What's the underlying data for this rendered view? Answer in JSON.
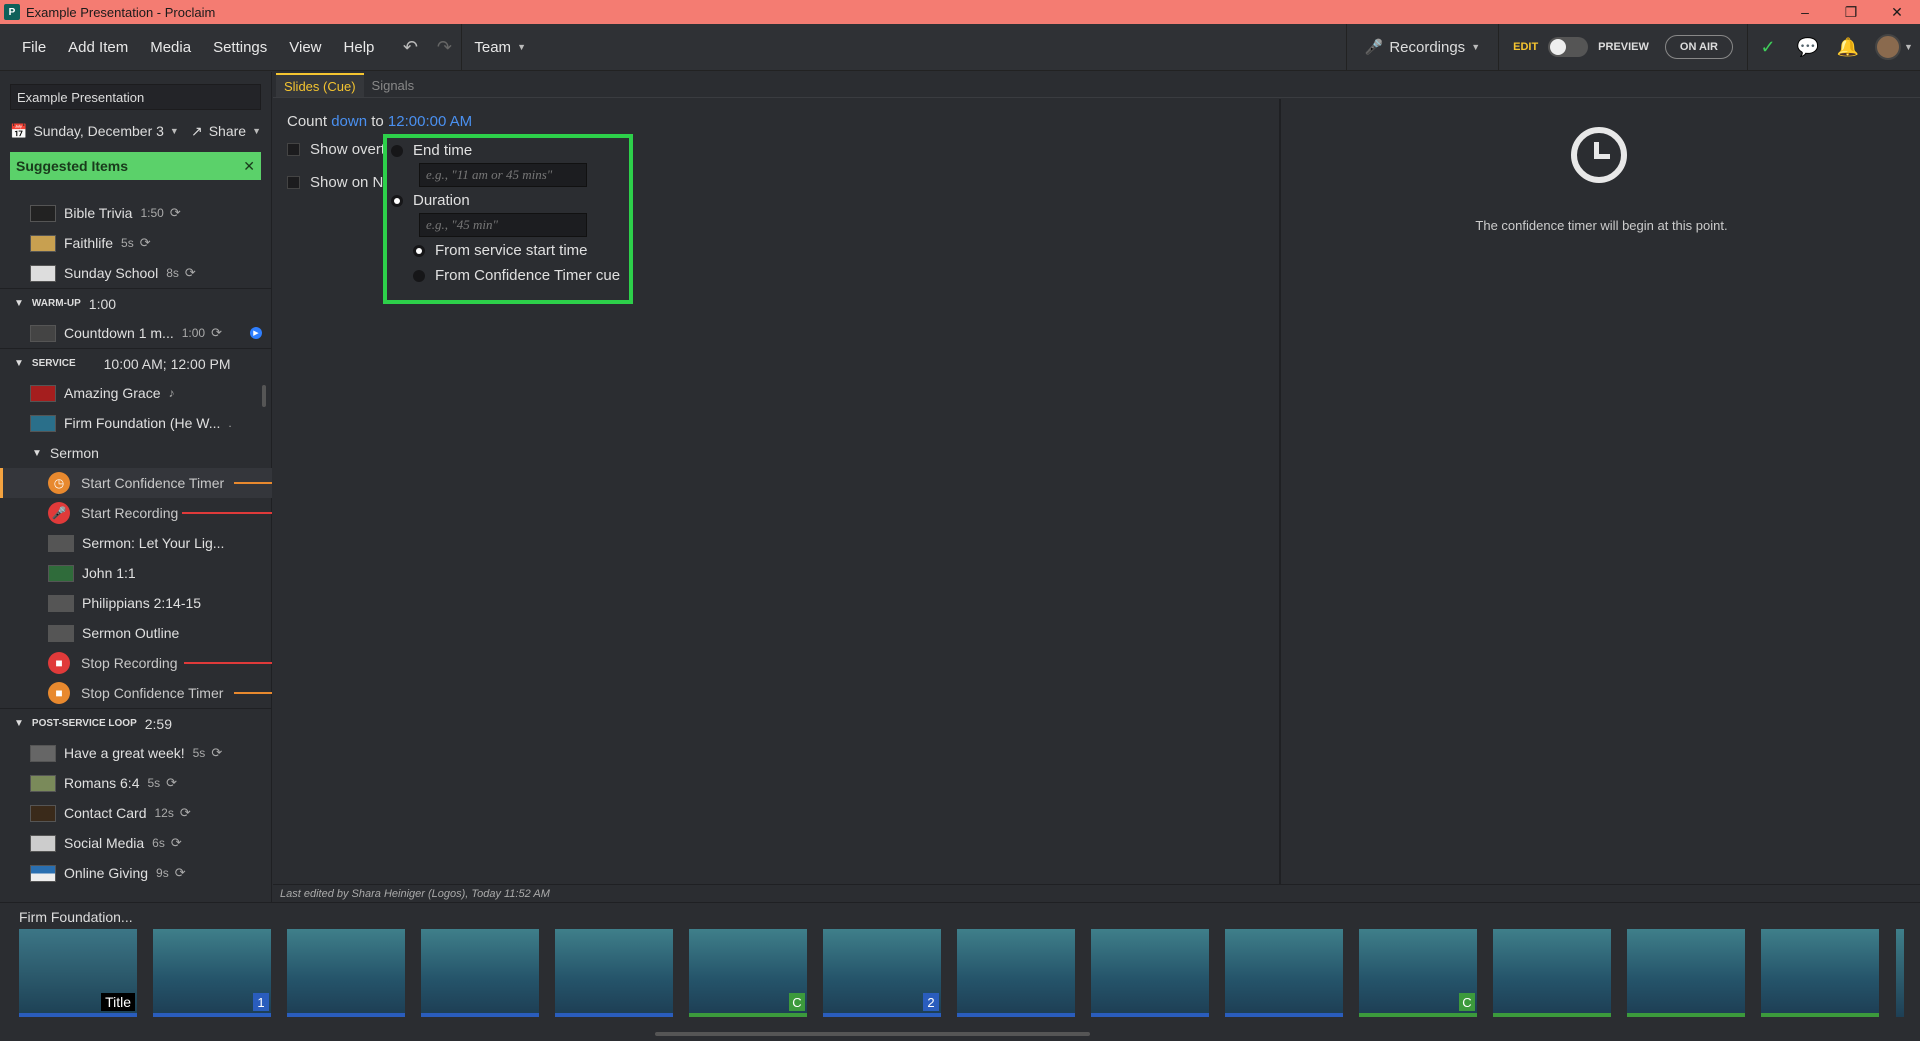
{
  "window": {
    "title": "Example Presentation - Proclaim"
  },
  "menu": {
    "items": [
      "File",
      "Add Item",
      "Media",
      "Settings",
      "View",
      "Help"
    ],
    "team": "Team",
    "recordings": "Recordings",
    "edit": "EDIT",
    "preview": "PREVIEW",
    "on_air": "ON AIR"
  },
  "sidebar": {
    "presentation_title": "Example Presentation",
    "date": "Sunday, December 3",
    "share": "Share",
    "suggested": "Suggested Items",
    "pre_items": [
      {
        "name": "Bible Trivia",
        "dur": "1:50",
        "color": "#222"
      },
      {
        "name": "Faithlife",
        "dur": "5s",
        "color": "#c8a050"
      },
      {
        "name": "Sunday School",
        "dur": "8s",
        "color": "#ddd"
      }
    ],
    "warmup": {
      "label": "WARM-UP",
      "value": "1:00",
      "item": "Countdown 1 m...",
      "dur": "1:00"
    },
    "service": {
      "label": "SERVICE",
      "value": "10:00 AM; 12:00 PM",
      "items": [
        {
          "name": "Amazing Grace",
          "extra": "♪"
        },
        {
          "name": "Firm Foundation (He W...",
          "extra": "."
        }
      ],
      "group": "Sermon",
      "cues": [
        {
          "name": "Start Confidence Timer",
          "icon": "clock",
          "color": "#e8892e",
          "line": "#e8892e"
        },
        {
          "name": "Start Recording",
          "icon": "mic",
          "color": "#e03a3a",
          "line": "#e03a3a"
        }
      ],
      "sermon_items": [
        "Sermon: Let Your Lig...",
        "John 1:1",
        "Philippians 2:14-15",
        "Sermon Outline"
      ],
      "end_cues": [
        {
          "name": "Stop Recording",
          "color": "#e03a3a"
        },
        {
          "name": "Stop Confidence Timer",
          "color": "#e8892e"
        }
      ]
    },
    "post": {
      "label": "POST-SERVICE LOOP",
      "value": "2:59",
      "items": [
        {
          "name": "Have a great week!",
          "dur": "5s"
        },
        {
          "name": "Romans 6:4",
          "dur": "5s"
        },
        {
          "name": "Contact Card",
          "dur": "12s"
        },
        {
          "name": "Social Media",
          "dur": "6s"
        },
        {
          "name": "Online Giving",
          "dur": "9s"
        }
      ]
    }
  },
  "tabs": [
    "Slides (Cue)",
    "Signals"
  ],
  "main": {
    "count_prefix": "Count",
    "count_dir": "down",
    "count_to": "to",
    "count_time": "12:00:00 AM",
    "show_overtime": "Show overti",
    "show_on": "Show on No",
    "end_time_label": "End time",
    "end_time_placeholder": "e.g., \"11 am or 45 mins\"",
    "duration_label": "Duration",
    "duration_placeholder": "e.g., \"45 min\"",
    "from_service": "From service start time",
    "from_cue": "From Confidence Timer cue"
  },
  "preview": {
    "text": "The confidence timer will begin at this point."
  },
  "status": "Last edited by Shara Heiniger (Logos), Today 11:52 AM",
  "strip": {
    "title": "Firm Foundation...",
    "slides": [
      {
        "badge": "Title",
        "kind": "title"
      },
      {
        "badge": "1",
        "kind": "num"
      },
      {
        "badge": "",
        "kind": ""
      },
      {
        "badge": "",
        "kind": ""
      },
      {
        "badge": "",
        "kind": ""
      },
      {
        "badge": "C",
        "kind": "c"
      },
      {
        "badge": "2",
        "kind": "num"
      },
      {
        "badge": "",
        "kind": ""
      },
      {
        "badge": "",
        "kind": ""
      },
      {
        "badge": "",
        "kind": ""
      },
      {
        "badge": "C",
        "kind": "c"
      },
      {
        "badge": "",
        "kind": "g"
      },
      {
        "badge": "",
        "kind": "g"
      },
      {
        "badge": "",
        "kind": "g"
      }
    ]
  }
}
